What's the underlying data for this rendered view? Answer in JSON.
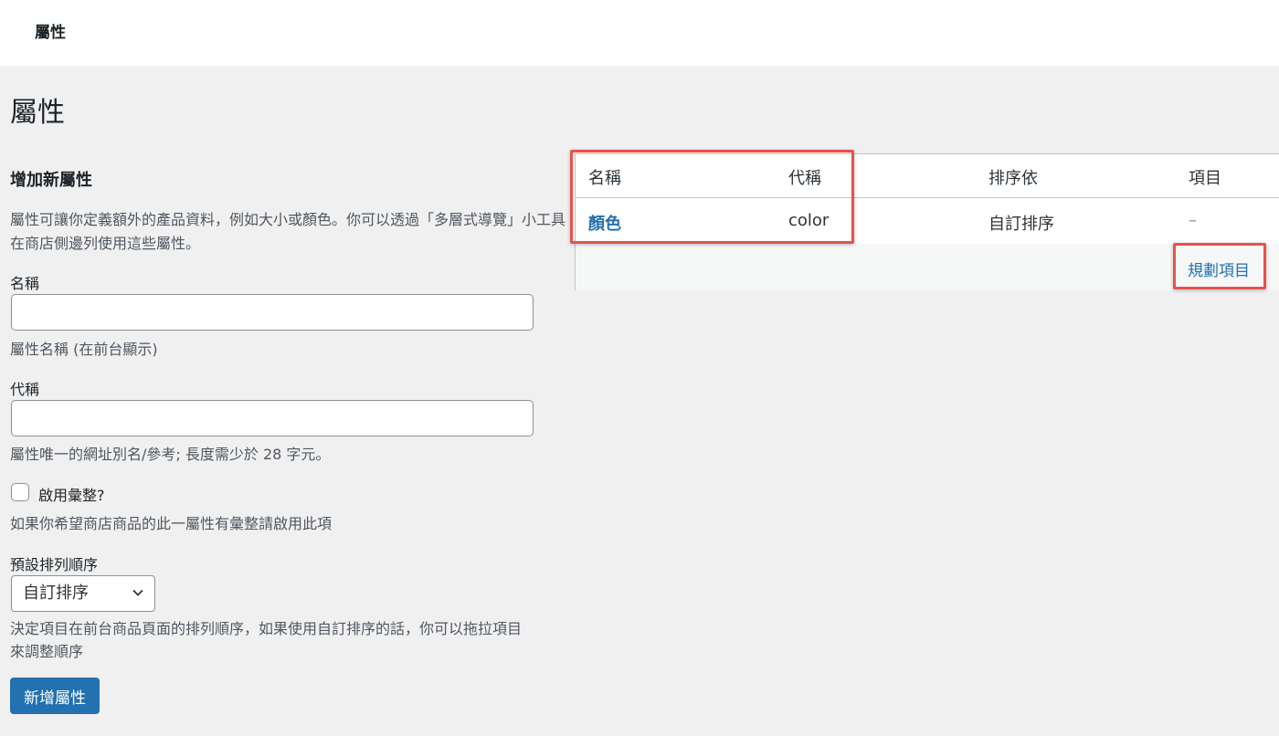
{
  "header": {
    "title": "屬性"
  },
  "page": {
    "title": "屬性"
  },
  "form": {
    "heading": "增加新屬性",
    "description": "屬性可讓你定義額外的產品資料，例如大小或顏色。你可以透過「多層式導覽」小工具在商店側邊列使用這些屬性。",
    "name_label": "名稱",
    "name_value": "",
    "name_help": "屬性名稱 (在前台顯示)",
    "slug_label": "代稱",
    "slug_value": "",
    "slug_help": "屬性唯一的網址別名/參考; 長度需少於 28 字元。",
    "archive_label": "啟用彙整?",
    "archive_checked": false,
    "archive_help": "如果你希望商店商品的此一屬性有彙整請啟用此項",
    "order_label": "預設排列順序",
    "order_selected": "自訂排序",
    "order_help": "決定項目在前台商品頁面的排列順序，如果使用自訂排序的話，你可以拖拉項目來調整順序",
    "submit_label": "新增屬性"
  },
  "table": {
    "headers": {
      "name": "名稱",
      "slug": "代稱",
      "order_by": "排序依",
      "terms": "項目"
    },
    "rows": [
      {
        "name": "顏色",
        "slug": "color",
        "order_by": "自訂排序",
        "terms": "–"
      }
    ],
    "configure_label": "規劃項目"
  },
  "colors": {
    "accent": "#2271b1",
    "highlight": "#e5534b",
    "background": "#f0f0f1"
  },
  "icons": {
    "select": "chevron-down-icon"
  }
}
